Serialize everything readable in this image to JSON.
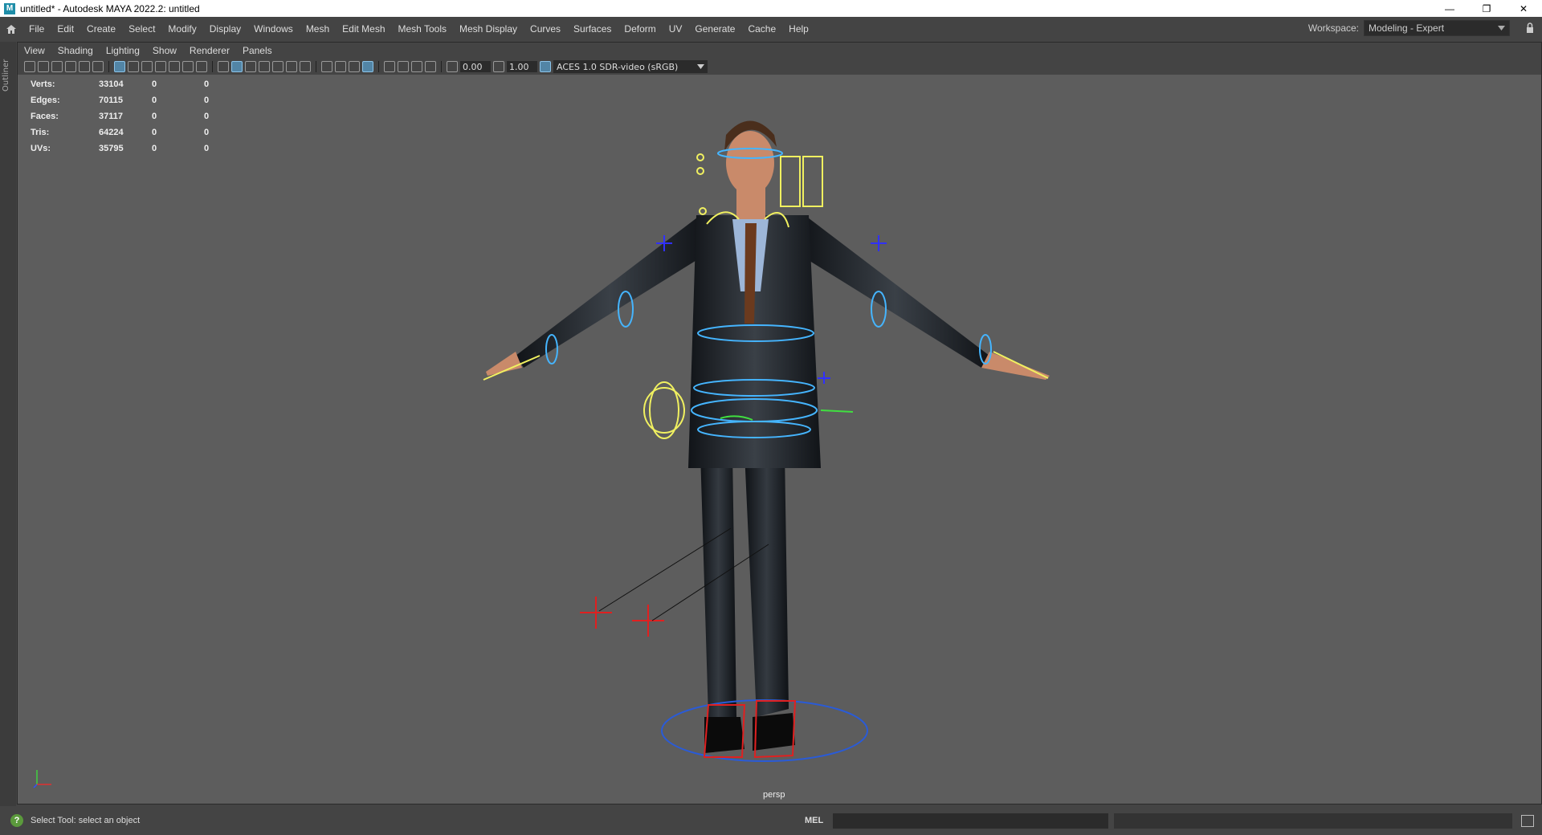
{
  "titlebar": {
    "app_icon": "M",
    "title": "untitled* - Autodesk MAYA 2022.2: untitled",
    "minimize": "—",
    "maximize": "❐",
    "close": "✕"
  },
  "menubar": {
    "items": [
      "File",
      "Edit",
      "Create",
      "Select",
      "Modify",
      "Display",
      "Windows",
      "Mesh",
      "Edit Mesh",
      "Mesh Tools",
      "Mesh Display",
      "Curves",
      "Surfaces",
      "Deform",
      "UV",
      "Generate",
      "Cache",
      "Help"
    ],
    "workspace_label": "Workspace:",
    "workspace_value": "Modeling - Expert"
  },
  "outliner": {
    "label": "Outliner"
  },
  "panel": {
    "menus": [
      "View",
      "Shading",
      "Lighting",
      "Show",
      "Renderer",
      "Panels"
    ],
    "exposure": "0.00",
    "gamma": "1.00",
    "colorspace": "ACES 1.0 SDR-video (sRGB)"
  },
  "hud": {
    "rows": [
      {
        "label": "Verts:",
        "v1": "33104",
        "v2": "0",
        "v3": "0"
      },
      {
        "label": "Edges:",
        "v1": "70115",
        "v2": "0",
        "v3": "0"
      },
      {
        "label": "Faces:",
        "v1": "37117",
        "v2": "0",
        "v3": "0"
      },
      {
        "label": "Tris:",
        "v1": "64224",
        "v2": "0",
        "v3": "0"
      },
      {
        "label": "UVs:",
        "v1": "35795",
        "v2": "0",
        "v3": "0"
      }
    ]
  },
  "viewport": {
    "camera": "persp"
  },
  "cmdbar": {
    "help_text": "Select Tool: select an object",
    "mel_label": "MEL"
  }
}
